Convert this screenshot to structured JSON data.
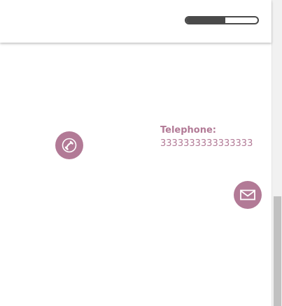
{
  "header": {
    "progress": 0.55
  },
  "contact": {
    "telephone_label": "Telephone:",
    "telephone_value": "3333333333333333"
  },
  "icons": {
    "phone": "phone-icon",
    "mail": "mail-icon"
  },
  "colors": {
    "accent": "#b27a96",
    "accent_text": "#b27a96",
    "progress_dark": "#4a4a4a"
  }
}
